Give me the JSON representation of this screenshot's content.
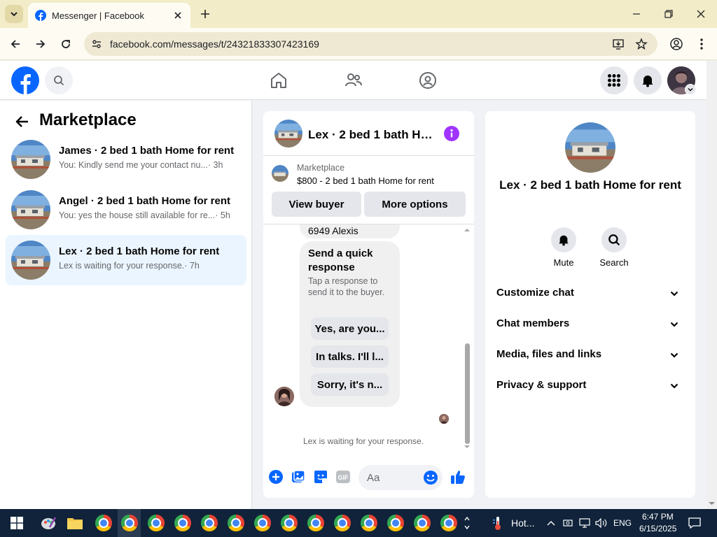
{
  "browser": {
    "tab_title": "Messenger | Facebook",
    "url": "facebook.com/messages/t/24321833307423169"
  },
  "left": {
    "title": "Marketplace",
    "conversations": [
      {
        "name": "James · 2 bed 1 bath Home for rent",
        "preview": "You: Kindly send me your contact nu...",
        "time": "· 3h",
        "active": false
      },
      {
        "name": "Angel · 2 bed 1 bath Home for rent",
        "preview": "You: yes the house still available for re...",
        "time": "· 5h",
        "active": false
      },
      {
        "name": "Lex · 2 bed 1 bath Home for rent",
        "preview": "Lex is waiting for your response.",
        "time": "· 7h",
        "active": true
      }
    ]
  },
  "chat": {
    "title": "Lex · 2 bed 1 bath Ho...",
    "marketplace_label": "Marketplace",
    "listing": "$800 - 2 bed 1 bath Home for rent",
    "view_buyer": "View buyer",
    "more_options": "More options",
    "prev_message_tail": "6949 Alexis",
    "quick_title": "Send a quick response",
    "quick_sub": "Tap a response to send it to the buyer.",
    "quick_options": [
      "Yes, are you...",
      "In talks. I'll l...",
      "Sorry, it's n..."
    ],
    "waiting": "Lex is waiting for your response.",
    "composer_placeholder": "Aa",
    "gif_label": "GIF"
  },
  "info": {
    "name": "Lex · 2 bed 1 bath Home for rent",
    "mute": "Mute",
    "search": "Search",
    "sections": [
      "Customize chat",
      "Chat members",
      "Media, files and links",
      "Privacy & support"
    ]
  },
  "taskbar": {
    "weather": "Hot...",
    "lang": "ENG",
    "time": "6:47 PM",
    "date": "6/15/2025"
  },
  "colors": {
    "accent": "#0866ff",
    "active_conv": "#ebf5ff",
    "info_purple": "#a033ff",
    "tabbar": "#f2ecc9"
  }
}
